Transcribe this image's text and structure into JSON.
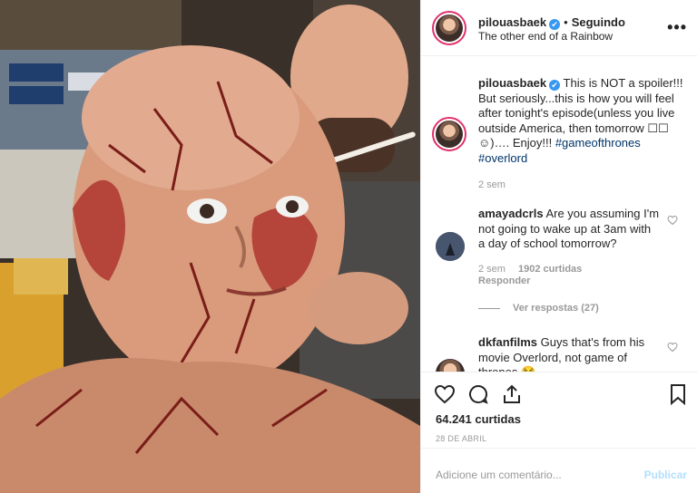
{
  "header": {
    "username": "pilouasbaek",
    "verified_mark": "✔",
    "separator": "•",
    "follow_status": "Seguindo",
    "location": "The other end of a Rainbow",
    "more_icon": "more-dots-icon"
  },
  "caption": {
    "username": "pilouasbaek",
    "text": "This is NOT a spoiler!!! But seriously...this is how you will feel after tonight's episode(unless you live outside America, then tomorrow ☐☐☺)…. Enjoy!!!",
    "tag1": "#gameofthrones",
    "tag2": "#overlord",
    "time": "2 sem"
  },
  "comments": [
    {
      "username": "amayadcrls",
      "text": "Are you assuming I'm not going to wake up at 3am with a day of school tomorrow?",
      "time": "2 sem",
      "likes": "1902 curtidas",
      "reply": "Responder",
      "view_replies": "Ver respostas (27)"
    },
    {
      "username": "dkfanfilms",
      "text": "Guys that's from his movie Overlord, not game of thrones 😂"
    }
  ],
  "actions": {
    "likes": "64.241 curtidas",
    "date": "28 DE ABRIL"
  },
  "add_comment": {
    "placeholder": "Adicione um comentário...",
    "publish": "Publicar"
  },
  "colors": {
    "accent_blue": "#3897f0",
    "publish_disabled": "#b2dffc",
    "hashtag": "#003569"
  }
}
